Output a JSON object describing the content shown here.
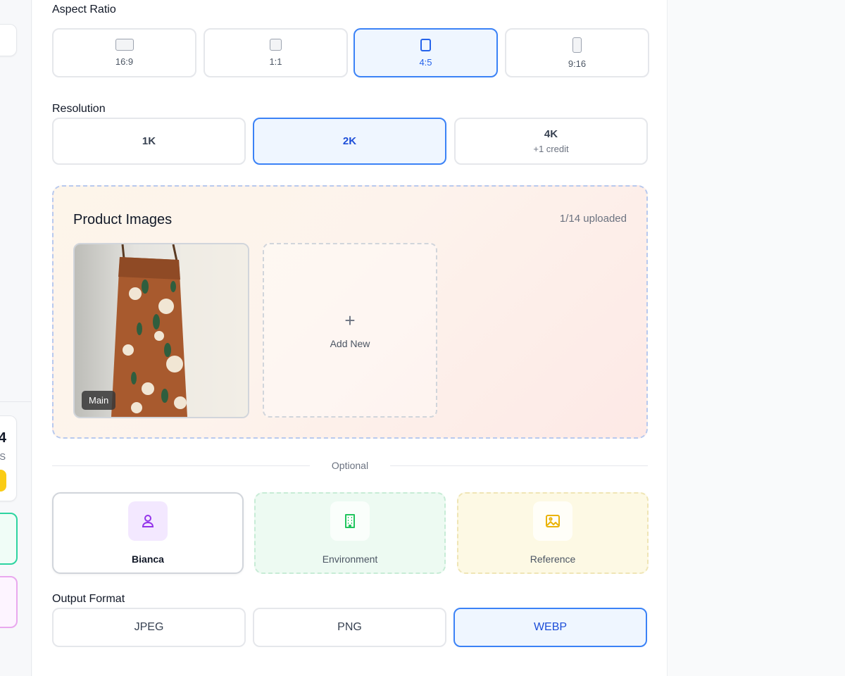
{
  "sidebar": {
    "stat_number": "4",
    "stat_sub": "S"
  },
  "aspect_ratio": {
    "label": "Aspect Ratio",
    "options": [
      {
        "label": "16:9",
        "selected": false
      },
      {
        "label": "1:1",
        "selected": false
      },
      {
        "label": "4:5",
        "selected": true
      },
      {
        "label": "9:16",
        "selected": false
      }
    ]
  },
  "resolution": {
    "label": "Resolution",
    "options": [
      {
        "label": "1K",
        "sub": "",
        "selected": false
      },
      {
        "label": "2K",
        "sub": "",
        "selected": true
      },
      {
        "label": "4K",
        "sub": "+1 credit",
        "selected": false
      }
    ]
  },
  "product_images": {
    "title": "Product Images",
    "count": "1/14 uploaded",
    "main_tag": "Main",
    "add_new": "Add New"
  },
  "optional": {
    "label": "Optional",
    "cards": {
      "model": "Bianca",
      "environment": "Environment",
      "reference": "Reference"
    }
  },
  "output_format": {
    "label": "Output Format",
    "options": [
      {
        "label": "JPEG",
        "selected": false
      },
      {
        "label": "PNG",
        "selected": false
      },
      {
        "label": "WEBP",
        "selected": true
      }
    ]
  },
  "colors": {
    "accent": "#3b82f6",
    "accent_bg": "#eff6ff",
    "model_icon": "#9333ea",
    "environment_icon": "#22c55e",
    "reference_icon": "#eab308",
    "sidebar_badge": "#facc15"
  },
  "icons": {
    "model": "user-icon",
    "environment": "building-icon",
    "reference": "image-icon",
    "add": "plus-icon"
  }
}
